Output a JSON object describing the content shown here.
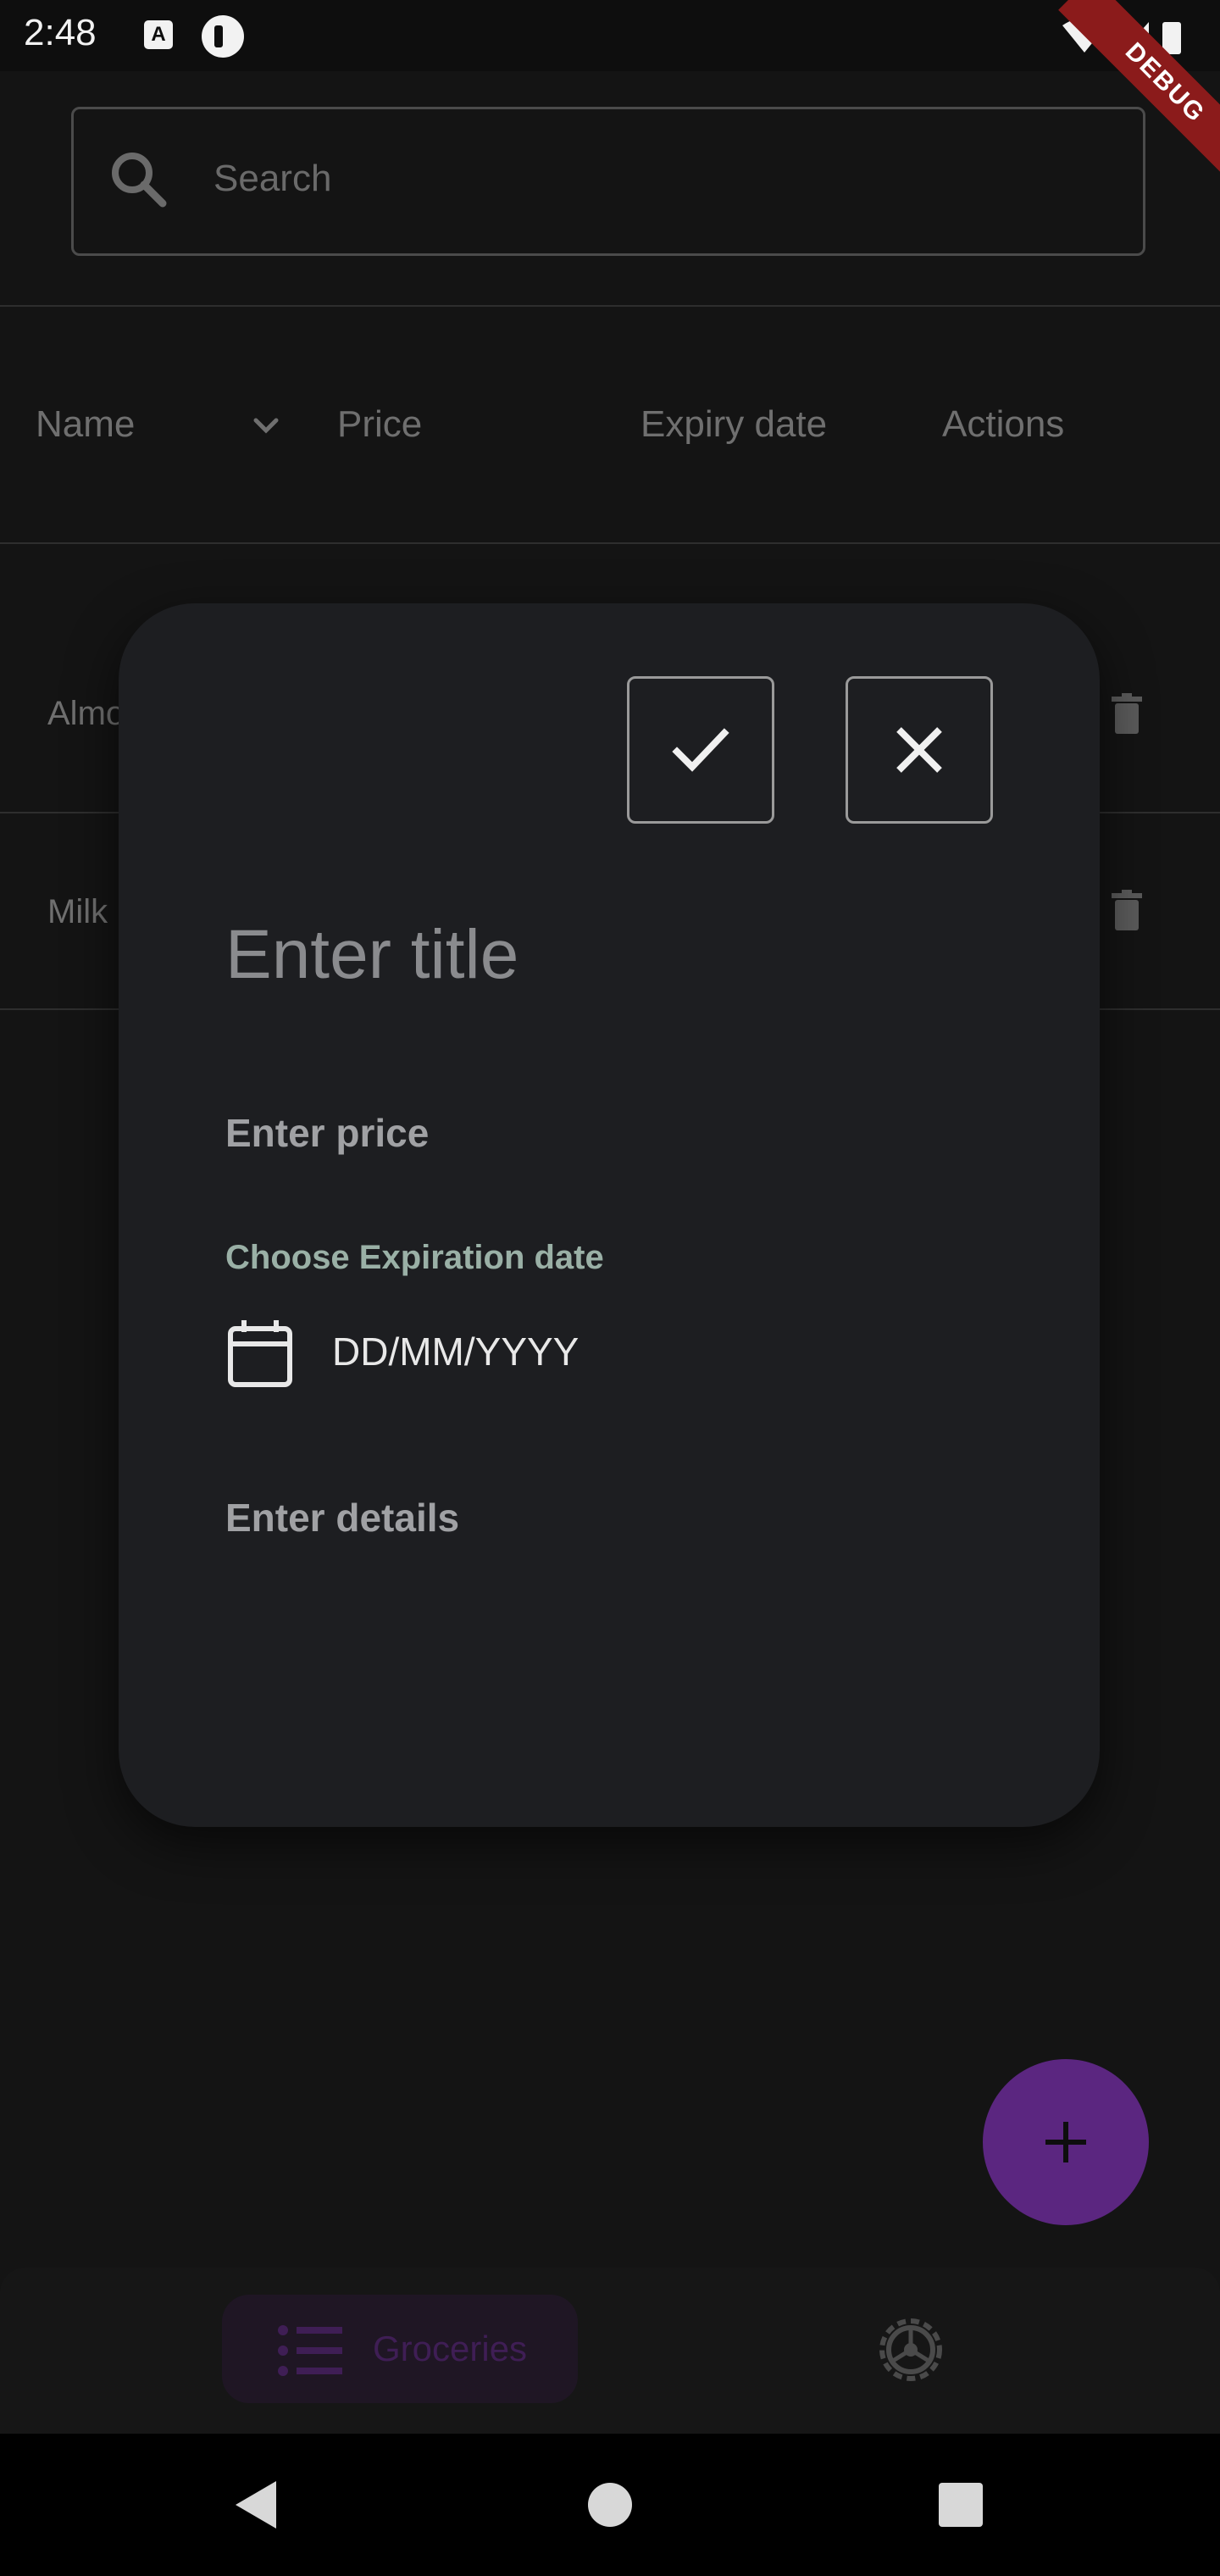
{
  "status_bar": {
    "time": "2:48",
    "a_badge": "A",
    "debug_label": "DEBUG"
  },
  "search": {
    "placeholder": "Search"
  },
  "table": {
    "columns": [
      "Name",
      "Price",
      "Expiry date",
      "Actions"
    ],
    "rows": [
      {
        "name_partial": "Almo"
      },
      {
        "name_partial": "Milk"
      }
    ]
  },
  "dialog": {
    "title_placeholder": "Enter title",
    "price_placeholder": "Enter price",
    "expiration_label": "Choose Expiration date",
    "date_format": "DD/MM/YYYY",
    "details_placeholder": "Enter details"
  },
  "nav": {
    "items": [
      {
        "label": "Groceries",
        "icon": "list-icon",
        "active": true
      },
      {
        "label": "",
        "icon": "settings-icon",
        "active": false
      }
    ]
  },
  "colors": {
    "accent": "#5b2680",
    "surface": "#1d1e21",
    "background": "#141414"
  }
}
